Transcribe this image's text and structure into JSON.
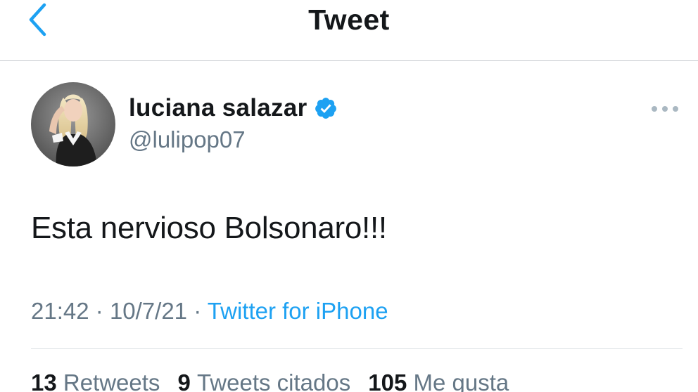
{
  "header": {
    "title": "Tweet",
    "back_icon": "chevron-left-icon"
  },
  "colors": {
    "accent": "#1da1f2",
    "text_primary": "#14171a",
    "text_secondary": "#657786",
    "divider": "#dbe0e4"
  },
  "author": {
    "display_name": "luciana salazar",
    "verified": true,
    "handle": "@lulipop07"
  },
  "tweet": {
    "text": "Esta nervioso Bolsonaro!!!",
    "time": "21:42",
    "separator": "·",
    "date": "10/7/21",
    "source": "Twitter for iPhone"
  },
  "stats": [
    {
      "count": "13",
      "label": "Retweets"
    },
    {
      "count": "9",
      "label": "Tweets citados"
    },
    {
      "count": "105",
      "label": "Me gusta"
    }
  ]
}
